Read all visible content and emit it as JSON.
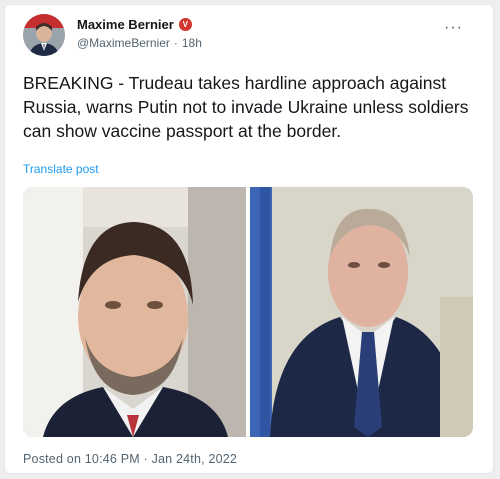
{
  "author": {
    "display_name": "Maxime Bernier",
    "verified_glyph": "V",
    "handle": "@MaximeBernier",
    "separator": "·",
    "age": "18h"
  },
  "tweet": {
    "text": "BREAKING - Trudeau takes hardline approach against Russia, warns Putin not to invade Ukraine unless soldiers can show vaccine passport at the border.",
    "translate_label": "Translate post",
    "posted_label": "Posted on 10:46 PM · Jan 24th, 2022"
  },
  "icons": {
    "more": "more-horizontal-icon",
    "verified": "verified-badge-icon"
  },
  "colors": {
    "link": "#1d9bf0",
    "verified_badge": "#d0342c",
    "text": "#14171a",
    "secondary_text": "#536471"
  }
}
